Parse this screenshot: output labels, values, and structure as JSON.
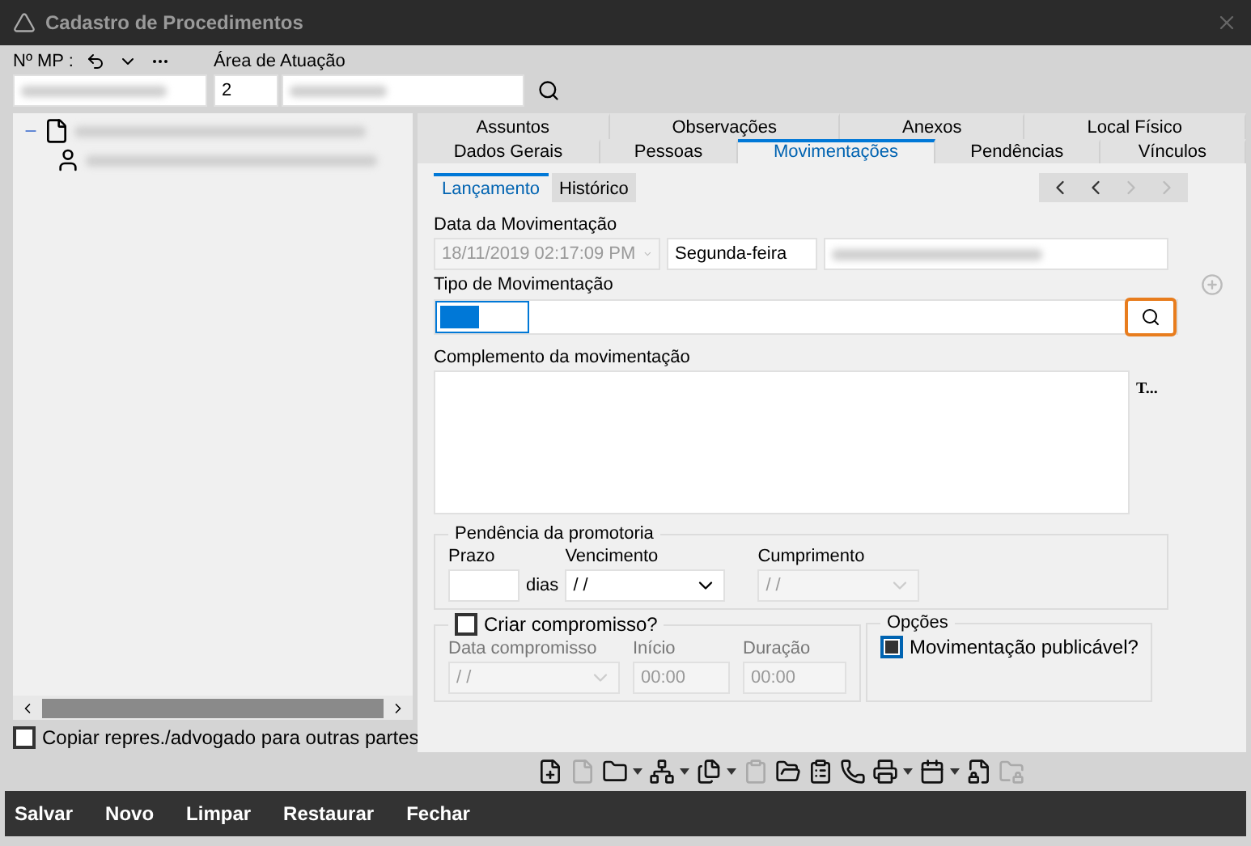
{
  "window": {
    "title": "Cadastro de Procedimentos"
  },
  "header": {
    "mp_label": "Nº MP :",
    "area_label": "Área de Atuação",
    "area_code": "2"
  },
  "tree": {
    "items": [
      {
        "kind": "folder",
        "expanded": true,
        "children": [
          {
            "kind": "person"
          }
        ]
      }
    ]
  },
  "copy_option": {
    "label": "Copiar repres./advogado para outras partes",
    "checked": false
  },
  "tabs_top": [
    {
      "label": "Assuntos",
      "selected": false
    },
    {
      "label": "Observações",
      "selected": false
    },
    {
      "label": "Anexos",
      "selected": false
    },
    {
      "label": "Local Físico",
      "selected": false
    }
  ],
  "tabs_bottom": [
    {
      "label": "Dados Gerais",
      "selected": false
    },
    {
      "label": "Pessoas",
      "selected": false
    },
    {
      "label": "Movimentações",
      "selected": true
    },
    {
      "label": "Pendências",
      "selected": false
    },
    {
      "label": "Vínculos",
      "selected": false
    }
  ],
  "subtabs": [
    {
      "label": "Lançamento",
      "selected": true
    },
    {
      "label": "Histórico",
      "selected": false
    }
  ],
  "nav": [
    {
      "kind": "first",
      "disabled": false
    },
    {
      "kind": "prev",
      "disabled": false
    },
    {
      "kind": "next",
      "disabled": true
    },
    {
      "kind": "last",
      "disabled": true
    }
  ],
  "movement": {
    "date_label": "Data da Movimentação",
    "date": "18/11/2019 02:17:09 PM",
    "weekday": "Segunda-feira",
    "type_label": "Tipo de Movimentação",
    "complement_label": "Complemento da movimentação",
    "complement_hint": "T..."
  },
  "pending": {
    "title": "Pendência da promotoria",
    "term_label": "Prazo",
    "days": "dias",
    "due_label": "Vencimento",
    "due": " /  /",
    "done_label": "Cumprimento",
    "done": " /  /"
  },
  "appointment": {
    "label": "Criar compromisso?",
    "checked": false,
    "date_label": "Data compromisso",
    "date": " /  /",
    "start_label": "Início",
    "start": "00:00",
    "duration_label": "Duração",
    "duration": "00:00"
  },
  "options": {
    "title": "Opções",
    "label": "Movimentação publicável?",
    "checked": true
  },
  "toolbar": [
    {
      "kind": "file-plus",
      "disabled": false,
      "dropdown": false
    },
    {
      "kind": "file",
      "disabled": true,
      "dropdown": false
    },
    {
      "kind": "folder",
      "disabled": false,
      "dropdown": true
    },
    {
      "kind": "network",
      "disabled": false,
      "dropdown": true
    },
    {
      "kind": "files",
      "disabled": false,
      "dropdown": true
    },
    {
      "kind": "clipboard",
      "disabled": true,
      "dropdown": false
    },
    {
      "kind": "folder-open",
      "disabled": false,
      "dropdown": false
    },
    {
      "kind": "clipboard-list",
      "disabled": false,
      "dropdown": false
    },
    {
      "kind": "phone",
      "disabled": false,
      "dropdown": false
    },
    {
      "kind": "printer",
      "disabled": false,
      "dropdown": true
    },
    {
      "kind": "calendar",
      "disabled": false,
      "dropdown": true
    },
    {
      "kind": "file-lock",
      "disabled": false,
      "dropdown": false
    },
    {
      "kind": "folder-lock",
      "disabled": true,
      "dropdown": false
    }
  ],
  "actions": [
    "Salvar",
    "Novo",
    "Limpar",
    "Restaurar",
    "Fechar"
  ]
}
